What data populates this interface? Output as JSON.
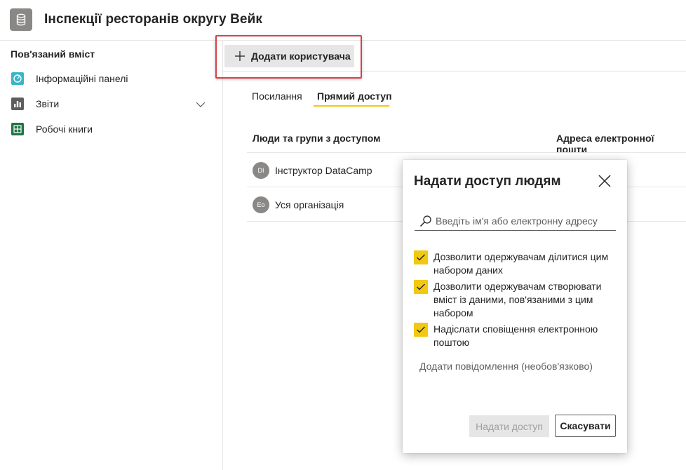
{
  "header": {
    "title": "Інспекції ресторанів округу Вейк",
    "icon": "database-icon"
  },
  "sidebar": {
    "heading": "Пов'язаний вміст",
    "items": [
      {
        "label": "Інформаційні панелі",
        "icon": "dashboard-icon",
        "color": "#3ab4c6"
      },
      {
        "label": "Звіти",
        "icon": "report-icon",
        "color": "#605e5c",
        "expandable": true
      },
      {
        "label": "Робочі книги",
        "icon": "workbook-icon",
        "color": "#217346"
      }
    ]
  },
  "toolbar": {
    "add_user_label": "Додати користувача"
  },
  "tabs": [
    {
      "label": "Посилання",
      "active": false
    },
    {
      "label": "Прямий доступ",
      "active": true
    }
  ],
  "table": {
    "headers": [
      "Люди та групи з доступом",
      "Адреса електронної пошти"
    ],
    "rows": [
      {
        "initials": "DI",
        "name": "Інструктор DataCamp"
      },
      {
        "initials": "Eo",
        "name": "Уся організація"
      }
    ]
  },
  "dialog": {
    "title": "Надати доступ людям",
    "search_placeholder": "Введіть ім'я або електронну адресу",
    "options": [
      {
        "label": "Дозволити одержувачам ділитися цим набором даних",
        "checked": true
      },
      {
        "label": "Дозволити одержувачам створювати вміст із даними, пов'язаними з цим набором",
        "checked": true
      },
      {
        "label": "Надіслати сповіщення електронною поштою",
        "checked": true
      }
    ],
    "add_message": "Додати повідомлення (необов'язково)",
    "grant_label": "Надати доступ",
    "cancel_label": "Скасувати"
  },
  "colors": {
    "accent": "#f2c811",
    "highlight_border": "#d74148",
    "text": "#252423",
    "muted": "#605e5c"
  }
}
